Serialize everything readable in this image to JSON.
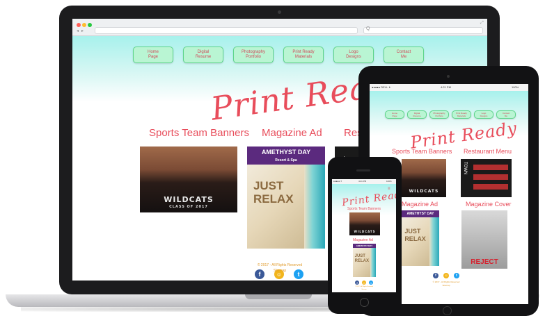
{
  "browser": {
    "address_placeholder": "",
    "search_placeholder": "Q"
  },
  "site": {
    "logo": "Print Ready",
    "nav": [
      {
        "line1": "Home",
        "line2": "Page"
      },
      {
        "line1": "Digital",
        "line2": "Resume"
      },
      {
        "line1": "Photography",
        "line2": "Portfolio"
      },
      {
        "line1": "Print Ready",
        "line2": "Materials"
      },
      {
        "line1": "Logo",
        "line2": "Designs"
      },
      {
        "line1": "Contact",
        "line2": "Me"
      }
    ],
    "sections": {
      "sports": "Sports Team Banners",
      "magazine_ad": "Magazine Ad",
      "restaurant_cut": "Rest",
      "restaurant_menu": "Restaurant Menu",
      "magazine_cover": "Magazine Cover"
    },
    "images": {
      "team_banner_text": "WILDCATS",
      "team_banner_sub": "CLASS OF 2017",
      "ad_brand": "AMETHYST DAY",
      "ad_brand_sub": "Resort & Spa",
      "ad_headline_1": "JUST",
      "ad_headline_2": "RELAX",
      "menu_brand": "TOWN",
      "cover_title": "REJECT"
    },
    "footer": {
      "copyright": "© 2017 - All Rights Reserved",
      "sitemap": "Sitemap"
    },
    "social": [
      {
        "icon": "facebook-icon",
        "glyph": "f",
        "color": "#3b5998"
      },
      {
        "icon": "snapchat-icon",
        "glyph": "☺",
        "color": "#f2b51c"
      },
      {
        "icon": "twitter-icon",
        "glyph": "t",
        "color": "#1da1f2"
      }
    ]
  },
  "tablet_status": {
    "carrier": "●●●●● DELL ✦",
    "time": "4:21 PM",
    "battery": "100%"
  },
  "phone_status": {
    "carrier": "●●●●● ✦",
    "time": "4:21 PM",
    "battery": "100%"
  },
  "colors": {
    "accent": "#e84d5b",
    "nav_button": "#b9f5d3",
    "nav_border": "#5dd58a",
    "header_teal": "#a7f1ec",
    "footer_text": "#e09a2a"
  }
}
